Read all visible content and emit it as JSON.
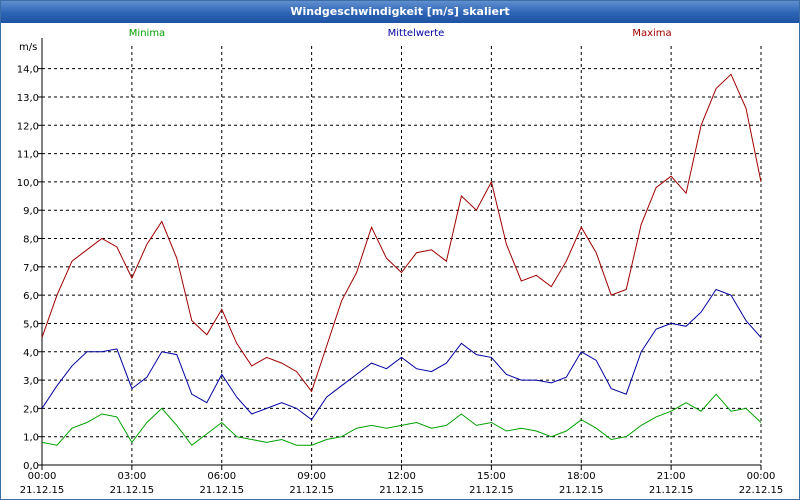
{
  "window": {
    "title": "Windgeschwindigkeit [m/s] skaliert"
  },
  "colors": {
    "min": "#00a000",
    "avg": "#0000a0",
    "max": "#a00000",
    "grid": "#000000"
  },
  "chart_data": {
    "type": "line",
    "title": "Windgeschwindigkeit [m/s] skaliert",
    "ylabel": "m/s",
    "xlabel": "",
    "ylim": [
      0,
      14.8
    ],
    "yticks": [
      "0,0",
      "1,0",
      "2,0",
      "3,0",
      "4,0",
      "5,0",
      "6,0",
      "7,0",
      "8,0",
      "9,0",
      "10,0",
      "11,0",
      "12,0",
      "13,0",
      "14,0"
    ],
    "xticks": [
      {
        "time": "00:00",
        "date": "21.12.15"
      },
      {
        "time": "03:00",
        "date": "21.12.15"
      },
      {
        "time": "06:00",
        "date": "21.12.15"
      },
      {
        "time": "09:00",
        "date": "21.12.15"
      },
      {
        "time": "12:00",
        "date": "21.12.15"
      },
      {
        "time": "15:00",
        "date": "21.12.15"
      },
      {
        "time": "18:00",
        "date": "21.12.15"
      },
      {
        "time": "21:00",
        "date": "21.12.15"
      },
      {
        "time": "00:00",
        "date": "22.12.15"
      }
    ],
    "grid": true,
    "legend_position": "top",
    "x_unit": "hours since 21.12.15 00:00",
    "series": [
      {
        "name": "Minima",
        "x": [
          0,
          0.5,
          1,
          1.5,
          2,
          2.5,
          3,
          3.5,
          4,
          4.5,
          5,
          5.5,
          6,
          6.5,
          7,
          7.5,
          8,
          8.5,
          9,
          9.5,
          10,
          10.5,
          11,
          11.5,
          12,
          12.5,
          13,
          13.5,
          14,
          14.5,
          15,
          15.5,
          16,
          16.5,
          17,
          17.5,
          18,
          18.5,
          19,
          19.5,
          20,
          20.5,
          21,
          21.5,
          22,
          22.5,
          23,
          23.5,
          24
        ],
        "values": [
          0.8,
          0.7,
          1.3,
          1.5,
          1.8,
          1.7,
          0.8,
          1.5,
          2.0,
          1.4,
          0.7,
          1.1,
          1.5,
          1.0,
          0.9,
          0.8,
          0.9,
          0.7,
          0.7,
          0.9,
          1.0,
          1.3,
          1.4,
          1.3,
          1.4,
          1.5,
          1.3,
          1.4,
          1.8,
          1.4,
          1.5,
          1.2,
          1.3,
          1.2,
          1.0,
          1.2,
          1.6,
          1.3,
          0.9,
          1.0,
          1.4,
          1.7,
          1.9,
          2.2,
          1.9,
          2.5,
          1.9,
          2.0,
          1.5
        ]
      },
      {
        "name": "Mittelwerte",
        "x": [
          0,
          0.5,
          1,
          1.5,
          2,
          2.5,
          3,
          3.5,
          4,
          4.5,
          5,
          5.5,
          6,
          6.5,
          7,
          7.5,
          8,
          8.5,
          9,
          9.5,
          10,
          10.5,
          11,
          11.5,
          12,
          12.5,
          13,
          13.5,
          14,
          14.5,
          15,
          15.5,
          16,
          16.5,
          17,
          17.5,
          18,
          18.5,
          19,
          19.5,
          20,
          20.5,
          21,
          21.5,
          22,
          22.5,
          23,
          23.5,
          24
        ],
        "values": [
          2.0,
          2.8,
          3.5,
          4.0,
          4.0,
          4.1,
          2.7,
          3.1,
          4.0,
          3.9,
          2.5,
          2.2,
          3.2,
          2.4,
          1.8,
          2.0,
          2.2,
          2.0,
          1.6,
          2.4,
          2.8,
          3.2,
          3.6,
          3.4,
          3.8,
          3.4,
          3.3,
          3.6,
          4.3,
          3.9,
          3.8,
          3.2,
          3.0,
          3.0,
          2.9,
          3.1,
          4.0,
          3.7,
          2.7,
          2.5,
          4.0,
          4.8,
          5.0,
          4.9,
          5.4,
          6.2,
          6.0,
          5.1,
          4.5
        ]
      },
      {
        "name": "Maxima",
        "x": [
          0,
          0.5,
          1,
          1.5,
          2,
          2.5,
          3,
          3.5,
          4,
          4.5,
          5,
          5.5,
          6,
          6.5,
          7,
          7.5,
          8,
          8.5,
          9,
          9.5,
          10,
          10.5,
          11,
          11.5,
          12,
          12.5,
          13,
          13.5,
          14,
          14.5,
          15,
          15.5,
          16,
          16.5,
          17,
          17.5,
          18,
          18.5,
          19,
          19.5,
          20,
          20.5,
          21,
          21.5,
          22,
          22.5,
          23,
          23.5,
          24
        ],
        "values": [
          4.5,
          6.0,
          7.2,
          7.6,
          8.0,
          7.7,
          6.6,
          7.8,
          8.6,
          7.3,
          5.1,
          4.6,
          5.5,
          4.3,
          3.5,
          3.8,
          3.6,
          3.3,
          2.6,
          4.2,
          5.8,
          6.8,
          8.4,
          7.3,
          6.8,
          7.5,
          7.6,
          7.2,
          9.5,
          9.0,
          10.0,
          7.8,
          6.5,
          6.7,
          6.3,
          7.2,
          8.4,
          7.5,
          6.0,
          6.2,
          8.5,
          9.8,
          10.2,
          9.6,
          12.0,
          13.3,
          13.8,
          12.6,
          10.0
        ]
      }
    ]
  }
}
